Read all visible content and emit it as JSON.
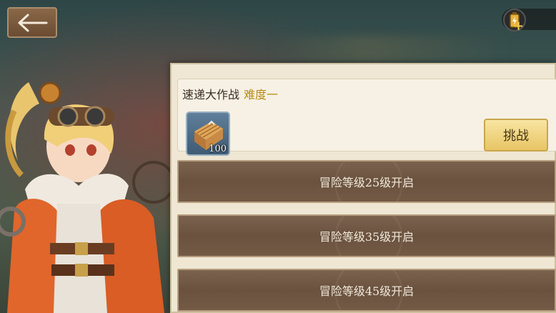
{
  "header": {
    "back_icon": "arrow-left-icon",
    "energy_icon": "battery-energy-icon",
    "energy_add": "+"
  },
  "event": {
    "title": "速递大作战",
    "difficulty": "难度一",
    "reward": {
      "icon": "wooden-crate-icon",
      "count": "100"
    },
    "challenge_label": "挑战"
  },
  "locked_tiers": [
    {
      "label": "冒险等级25级开启"
    },
    {
      "label": "冒险等级35级开启"
    },
    {
      "label": "冒险等级45级开启"
    }
  ],
  "colors": {
    "panel_bg": "#efe7d3",
    "difficulty_gold": "#b88b14",
    "challenge_gold": "#e8c565",
    "locked_brown": "#6a523f"
  }
}
